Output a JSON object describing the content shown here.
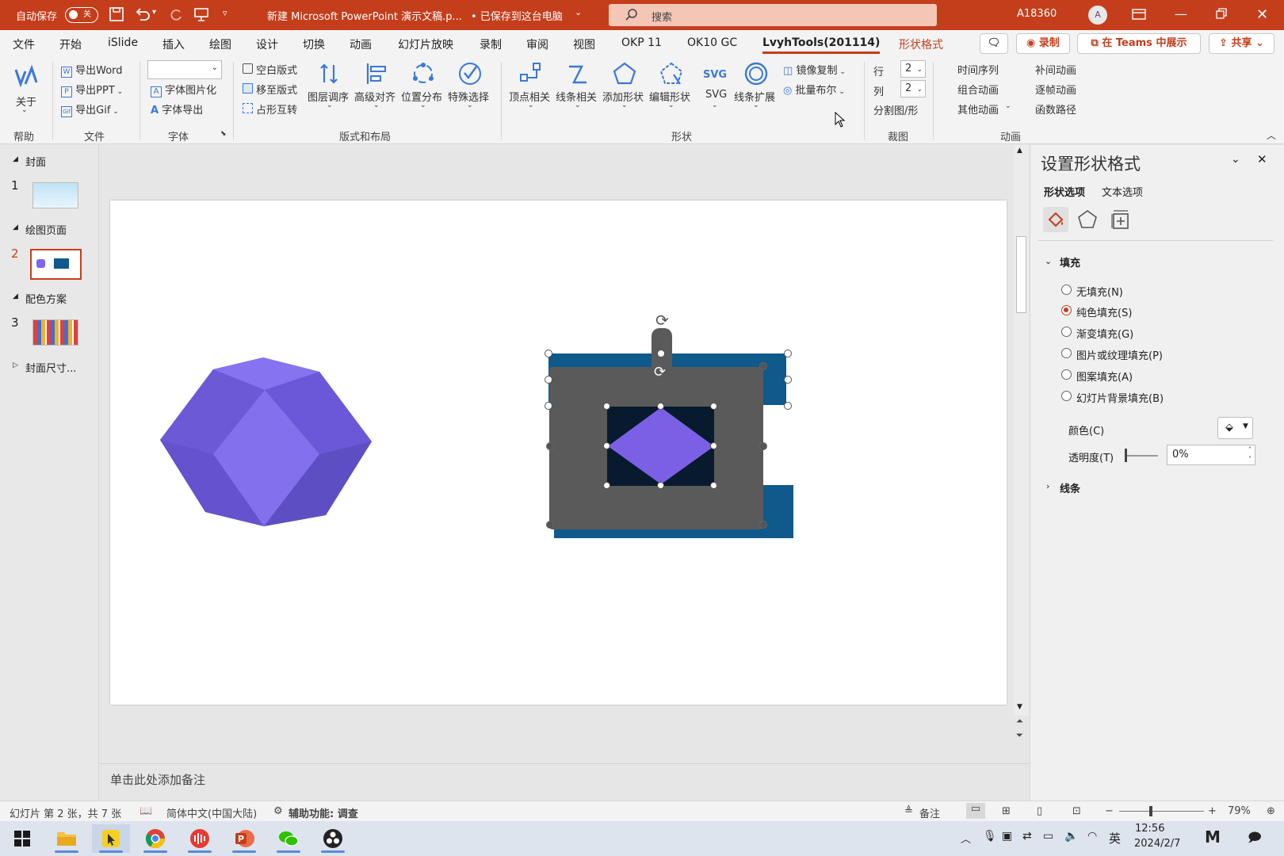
{
  "titlebar": {
    "autosave_label": "自动保存",
    "autosave_state": "关",
    "doc_title": "新建 Microsoft PowerPoint 演示文稿.p...",
    "save_status": "• 已保存到这台电脑",
    "search_placeholder": "搜索",
    "user": "A18360",
    "avatar_initial": "A"
  },
  "menu": {
    "items": [
      "文件",
      "开始",
      "iSlide",
      "插入",
      "绘图",
      "设计",
      "切换",
      "动画",
      "幻灯片放映",
      "录制",
      "审阅",
      "视图",
      "OKP 11",
      "OK10 GC",
      "LvyhTools(201114)",
      "形状格式"
    ],
    "record_button": "录制",
    "teams_button": "在 Teams 中展示",
    "share_button": "共享"
  },
  "ribbon": {
    "help": {
      "about": "关于",
      "group": "帮助"
    },
    "file": {
      "export_word": "导出Word",
      "export_ppt": "导出PPT",
      "export_gif": "导出Gif",
      "group": "文件"
    },
    "font": {
      "font_to_image": "字体图片化",
      "font_export": "字体导出",
      "group": "字体"
    },
    "layout": {
      "blank_layout": "空白版式",
      "move_layout": "移至版式",
      "placeholder_swap": "占形互转",
      "layer_order": "图层调序",
      "advanced_align": "高级对齐",
      "position_distribute": "位置分布",
      "special_select": "特殊选择",
      "group": "版式和布局"
    },
    "shape": {
      "vertex": "顶点相关",
      "lines": "线条相关",
      "add_shape": "添加形状",
      "edit_shape": "编辑形状",
      "svg": "SVG",
      "line_extend": "线条扩展",
      "mirror_copy": "镜像复制",
      "batch_boolean": "批量布尔",
      "group": "形状"
    },
    "crop": {
      "rows_label": "行",
      "rows_value": "2",
      "cols_label": "列",
      "cols_value": "2",
      "split": "分割图/形",
      "group": "裁图"
    },
    "animation": {
      "timeline": "时间序列",
      "combo": "组合动画",
      "other": "其他动画",
      "tween": "补间动画",
      "frame": "逐帧动画",
      "func_path": "函数路径",
      "group": "动画"
    }
  },
  "slides_panel": {
    "sections": [
      {
        "name": "封面",
        "number": "1"
      },
      {
        "name": "绘图页面",
        "number": "2"
      },
      {
        "name": "配色方案",
        "number": "3"
      },
      {
        "name": "封面尺寸..."
      }
    ]
  },
  "notes_placeholder": "单击此处添加备注",
  "format_pane": {
    "title": "设置形状格式",
    "tabs": [
      "形状选项",
      "文本选项"
    ],
    "fill_header": "填充",
    "options": [
      "无填充(N)",
      "纯色填充(S)",
      "渐变填充(G)",
      "图片或纹理填充(P)",
      "图案填充(A)",
      "幻灯片背景填充(B)"
    ],
    "selected": "纯色填充(S)",
    "color_label": "颜色(C)",
    "transparency_label": "透明度(T)",
    "transparency_value": "0%",
    "line_header": "线条"
  },
  "status": {
    "slide_info": "幻灯片 第 2 张，共 7 张",
    "language": "简体中文(中国大陆)",
    "accessibility": "辅助功能: 调查",
    "notes_btn": "备注",
    "zoom": "79%"
  },
  "taskbar": {
    "time": "12:56",
    "date": "2024/2/7",
    "ime": "英"
  },
  "colors": {
    "accent": "#c43e1c",
    "purple": "#7b68ee",
    "dark_blue": "#0f5a8a",
    "gray": "#5a5a5a",
    "navy": "#071a2e"
  }
}
